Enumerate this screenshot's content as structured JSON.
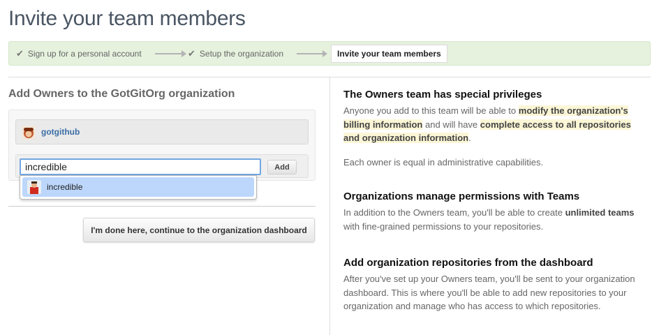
{
  "page": {
    "title": "Invite your team members"
  },
  "steps": [
    {
      "label": "Sign up for a personal account",
      "done": true
    },
    {
      "label": "Setup the organization",
      "done": true
    },
    {
      "label": "Invite your team members",
      "current": true
    }
  ],
  "owners": {
    "heading": "Add Owners to the GotGitOrg organization",
    "members": [
      {
        "name": "gotgithub"
      }
    ],
    "input_value": "incredible",
    "add_label": "Add",
    "suggestions": [
      {
        "name": "incredible"
      }
    ],
    "done_label": "I'm done here, continue to the organization dashboard"
  },
  "info": {
    "owners_title": "The Owners team has special privileges",
    "owners_p1": {
      "t1": "Anyone you add to this team will be able to ",
      "h1": "modify the organization's billing information",
      "t2": " and will have ",
      "h2": "complete access to all repositories and organization information",
      "t3": "."
    },
    "owners_p2": "Each owner is equal in administrative capabilities.",
    "teams_title": "Organizations manage permissions with Teams",
    "teams_p": {
      "t1": "In addition to the Owners team, you'll be able to create ",
      "b1": "unlimited teams",
      "t2": " with fine-grained permissions to your repositories."
    },
    "repos_title": "Add organization repositories from the dashboard",
    "repos_p": "After you've set up your Owners team, you'll be sent to your organization dashboard. This is where you'll be able to add new repositories to your organization and manage who has access to which repositories."
  },
  "colors": {
    "step_bar": "#e6f1de",
    "link": "#3b6ea5",
    "highlight": "#fbf6d6",
    "suggestion": "#bcd7fb"
  },
  "icons": {
    "check": "checkmark-icon",
    "arrow": "arrow-right-icon"
  }
}
